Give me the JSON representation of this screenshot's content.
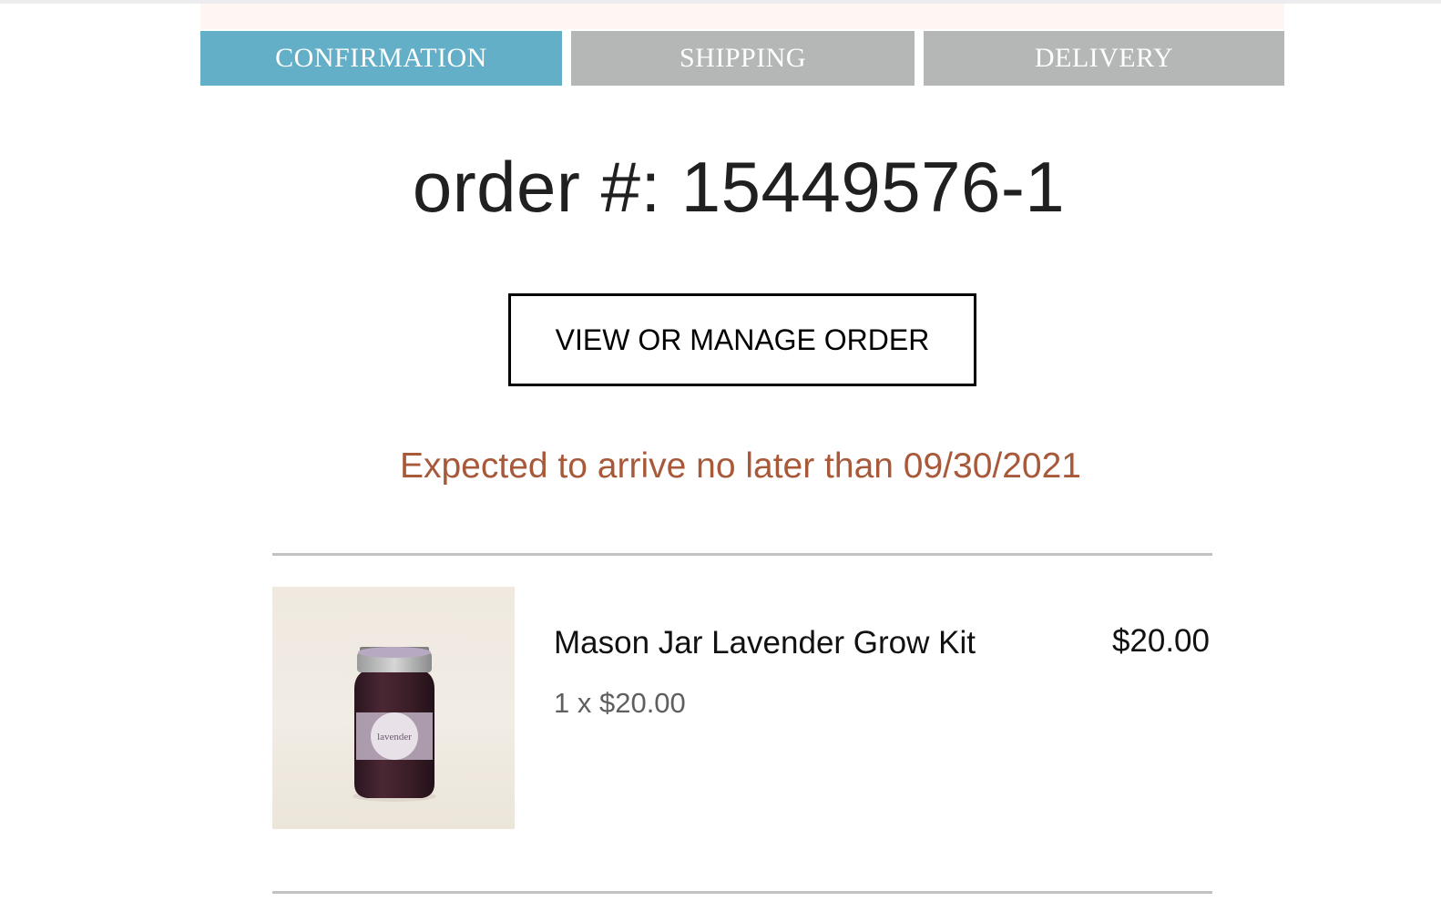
{
  "progress_steps": [
    {
      "label": "CONFIRMATION",
      "active": true
    },
    {
      "label": "SHIPPING",
      "active": false
    },
    {
      "label": "DELIVERY",
      "active": false
    }
  ],
  "order": {
    "number_text": "order #: 15449576-1",
    "manage_button_label": "VIEW OR MANAGE ORDER",
    "eta_text": "Expected to arrive no later than 09/30/2021"
  },
  "items": [
    {
      "name": "Mason Jar Lavender Grow Kit",
      "quantity_line": "1 x $20.00",
      "price": "$20.00",
      "jar_label": "lavender"
    }
  ],
  "colors": {
    "active_step": "#62afc7",
    "inactive_step": "#b5b7b6",
    "eta_text": "#a7593a",
    "banner_strip": "#fdf6f3"
  }
}
